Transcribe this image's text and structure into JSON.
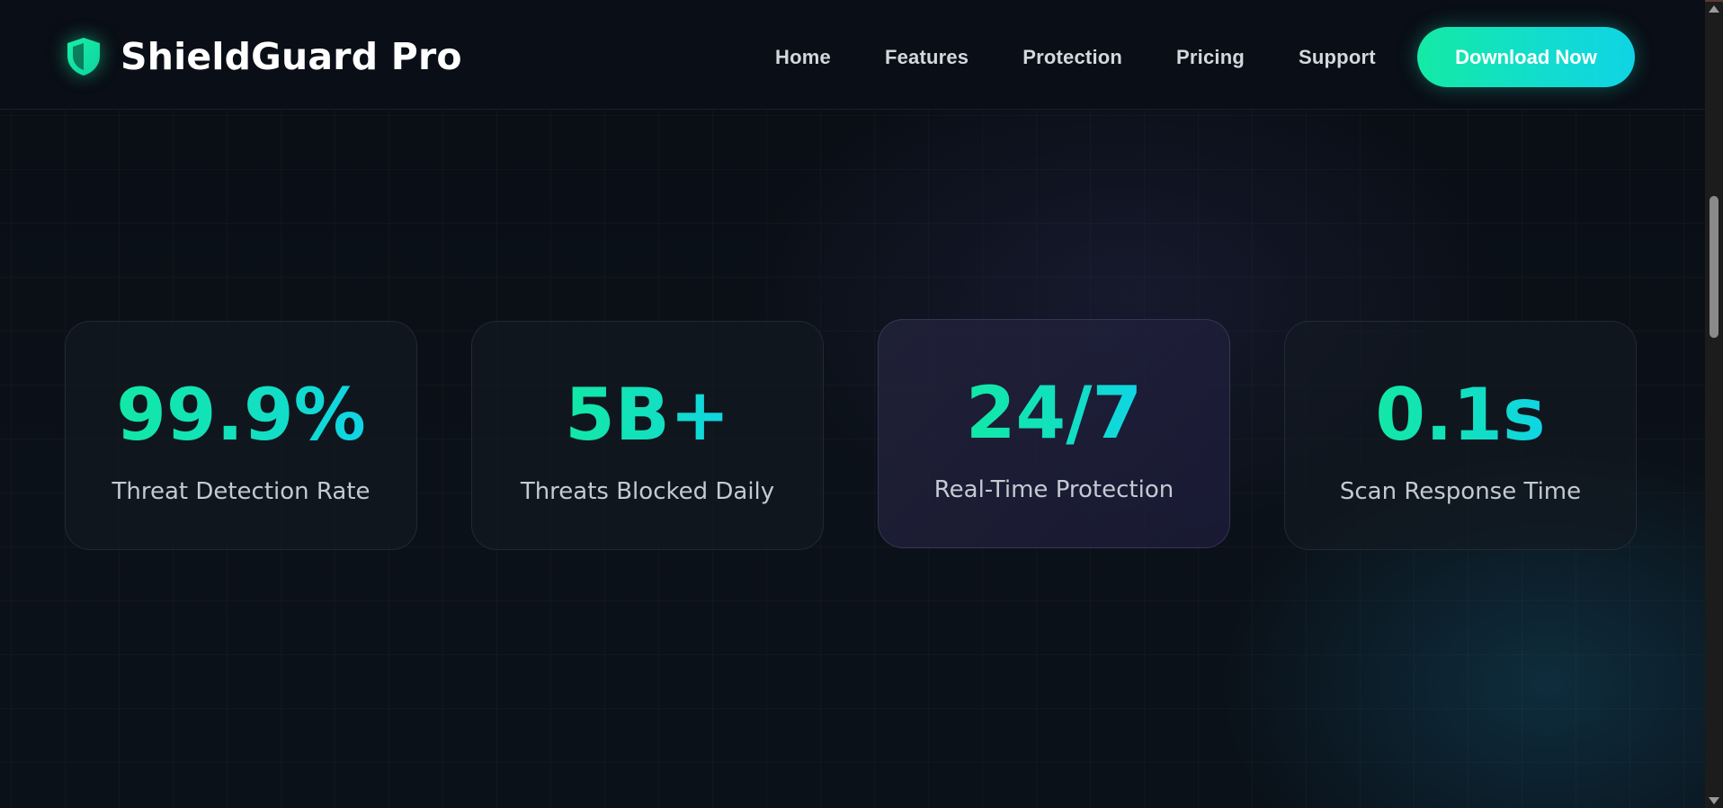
{
  "header": {
    "brand_name": "ShieldGuard Pro",
    "brand_icon": "shield-icon",
    "nav": [
      "Home",
      "Features",
      "Protection",
      "Pricing",
      "Support"
    ],
    "cta_label": "Download Now"
  },
  "stats": [
    {
      "value": "99.9%",
      "label": "Threat Detection Rate"
    },
    {
      "value": "5B+",
      "label": "Threats Blocked Daily"
    },
    {
      "value": "24/7",
      "label": "Real-Time Protection"
    },
    {
      "value": "0.1s",
      "label": "Scan Response Time"
    }
  ],
  "colors": {
    "accent_start": "#12e8a6",
    "accent_end": "#10d4e6",
    "background": "#0a0e15",
    "card_background": "#141a22",
    "active_card_background": "#22223a"
  }
}
